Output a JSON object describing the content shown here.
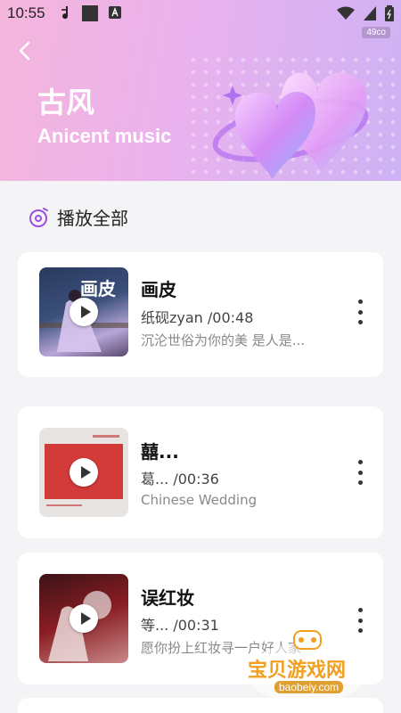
{
  "status_bar": {
    "time": "10:55"
  },
  "header": {
    "badge": "49co",
    "title_cn": "古风",
    "title_en": "Anicent music"
  },
  "play_all": {
    "label": "播放全部",
    "accent": "#9b4fe0"
  },
  "songs": [
    {
      "title": "画皮",
      "meta": "纸砚zyan  /00:48",
      "desc": "沉沦世俗为你的美 是人是...",
      "cover_text": "画皮"
    },
    {
      "title": "囍...",
      "meta": "葛...  /00:36",
      "desc": "Chinese Wedding"
    },
    {
      "title": "误红妆",
      "meta": "等...  /00:31",
      "desc": "愿你扮上红妆寻一户好人家"
    }
  ],
  "watermark": {
    "text": "宝贝游戏网",
    "url": "baobeiy.com"
  }
}
